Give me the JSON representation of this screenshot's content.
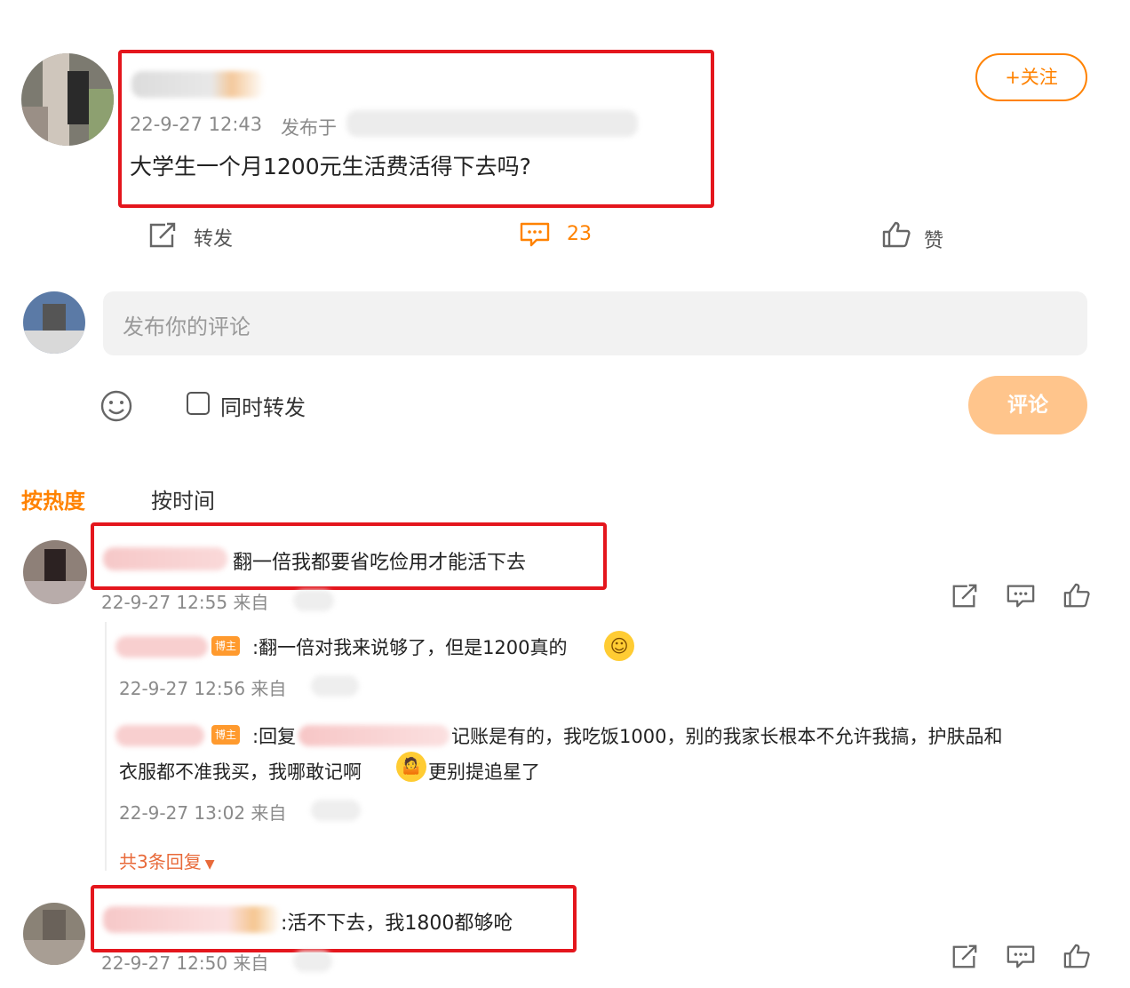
{
  "post": {
    "meta_time": "22-9-27 12:43",
    "meta_from": "发布于",
    "content": "大学生一个月1200元生活费活得下去吗?",
    "follow_label": "+关注",
    "actions": {
      "repost_label": "转发",
      "comment_count": "23",
      "like_label": "赞"
    }
  },
  "composer": {
    "placeholder": "发布你的评论",
    "repost_toggle_label": "同时转发",
    "submit_label": "评论"
  },
  "sort_tabs": {
    "hot": "按热度",
    "time": "按时间"
  },
  "comments": [
    {
      "text": "翻一倍我都要省吃俭用才能活下去",
      "meta": "22-9-27 12:55 来自",
      "replies": [
        {
          "badge": "博主",
          "text": ":翻一倍对我来说够了，但是1200真的",
          "meta": "22-9-27 12:56 来自"
        },
        {
          "badge": "博主",
          "prefix": ":回复",
          "text_line1": "记账是有的，我吃饭1000，别的我家长根本不允许我搞，护肤品和",
          "text_line2a": "衣服都不准我买，我哪敢记啊",
          "text_line2b": "更别提追星了",
          "meta": "22-9-27 13:02 来自"
        }
      ],
      "more_replies": "共3条回复"
    },
    {
      "text": ":活不下去，我1800都够呛",
      "meta": "22-9-27 12:50 来自"
    }
  ],
  "colors": {
    "accent": "#ff8200",
    "highlight_box": "#e4161d",
    "submit_bg": "#ffc58c"
  }
}
